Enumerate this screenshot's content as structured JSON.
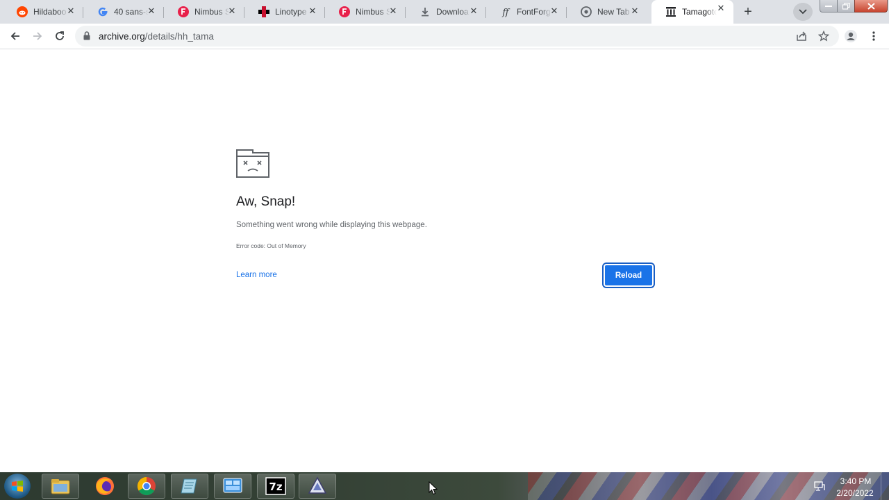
{
  "tabs": [
    {
      "title": "Hildaboo",
      "icon": "reddit-icon",
      "color": "#ff4500"
    },
    {
      "title": "40 sans-s",
      "icon": "google-icon",
      "color": "#4285f4"
    },
    {
      "title": "Nimbus S",
      "icon": "fontshop-icon",
      "color": "#e8204a"
    },
    {
      "title": "Linotype",
      "icon": "linotype-icon",
      "color": "#c8102e"
    },
    {
      "title": "Nimbus S",
      "icon": "fontshop-icon",
      "color": "#e8204a"
    },
    {
      "title": "Downloa",
      "icon": "download-icon",
      "color": "#5f6368"
    },
    {
      "title": "FontForg",
      "icon": "fontforge-icon",
      "color": "#3c4043"
    },
    {
      "title": "New Tab",
      "icon": "chrome-icon",
      "color": "#5f6368"
    },
    {
      "title": "Tamagotc",
      "icon": "archive-icon",
      "color": "#202124",
      "active": true
    }
  ],
  "address": {
    "host": "archive.org",
    "path": "/details/hh_tama"
  },
  "error": {
    "heading": "Aw, Snap!",
    "message": "Something went wrong while displaying this webpage.",
    "code": "Error code: Out of Memory",
    "learn_more": "Learn more",
    "reload": "Reload"
  },
  "taskbar": {
    "apps": [
      "explorer-icon",
      "firefox-icon",
      "chrome-icon",
      "notepad-icon",
      "control-panel-icon",
      "7zip-icon",
      "inkscape-icon"
    ],
    "time": "3:40 PM",
    "date": "2/20/2022"
  },
  "colors": {
    "accent": "#1a73e8",
    "tabstrip": "#dee1e6"
  }
}
